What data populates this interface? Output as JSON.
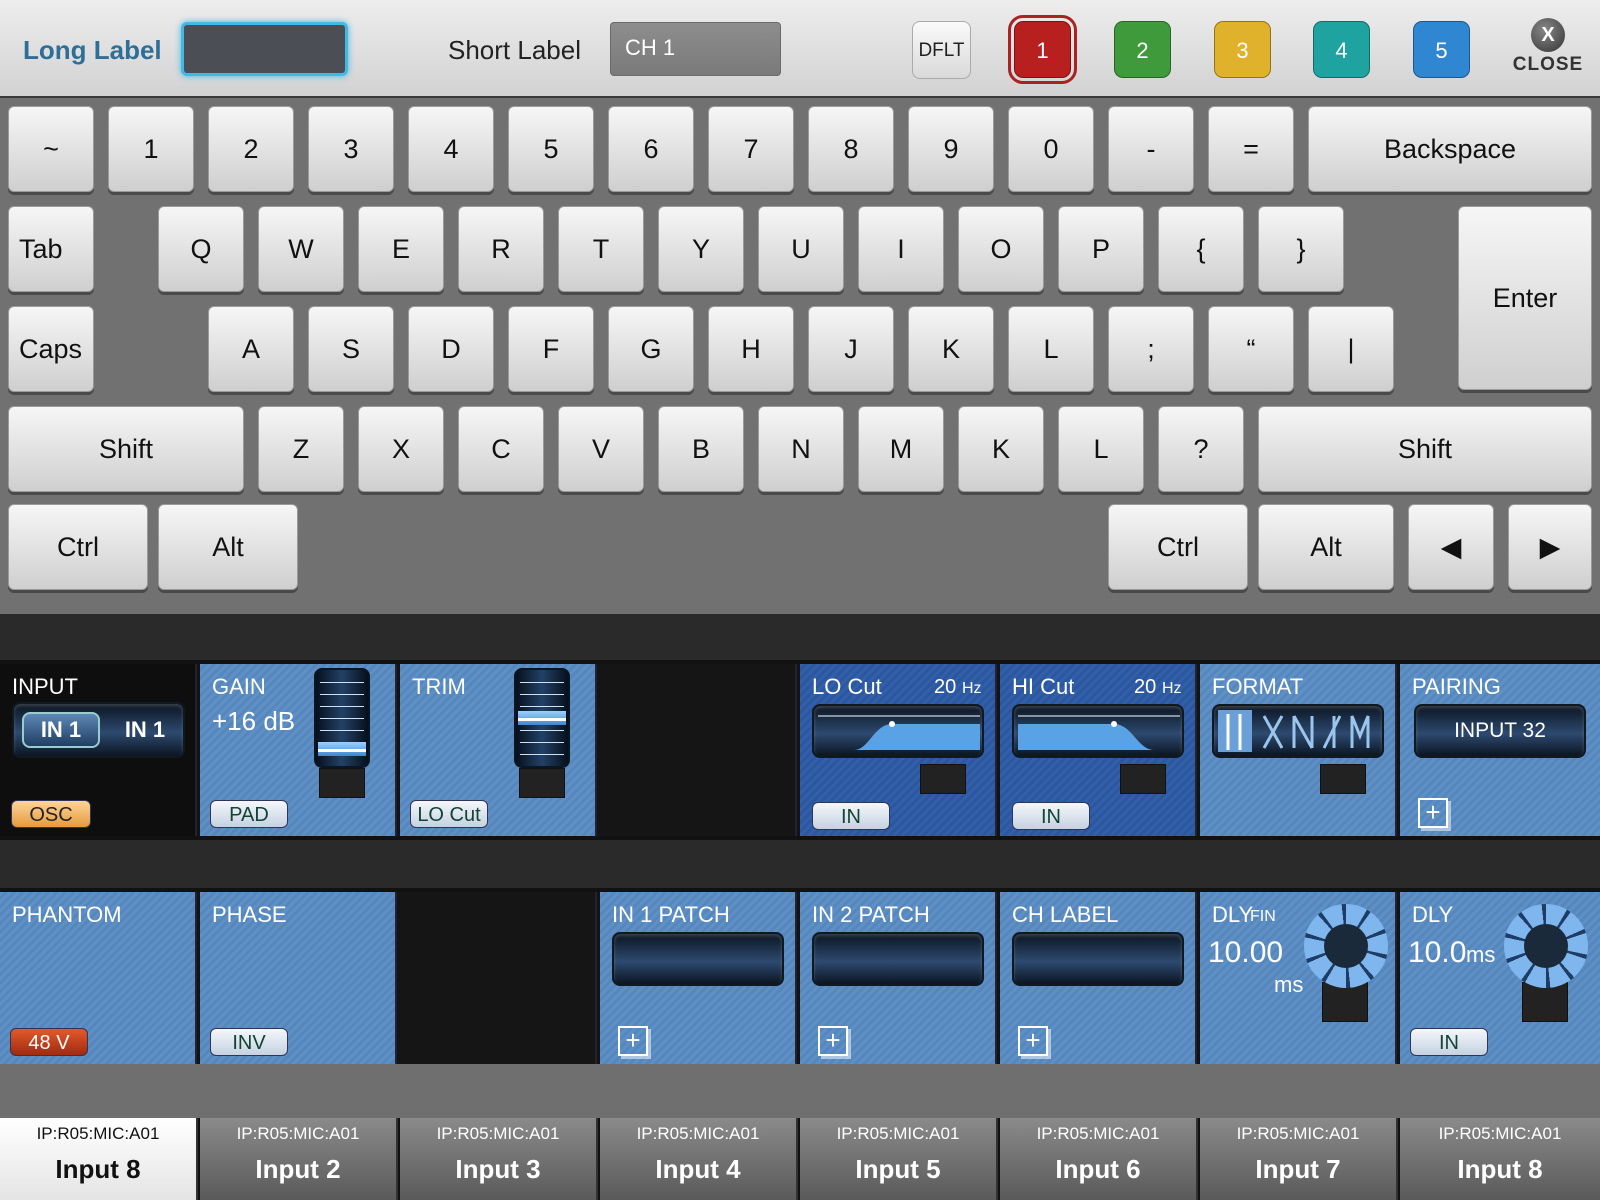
{
  "header": {
    "long_label": "Long Label",
    "long_value": "",
    "short_label": "Short Label",
    "short_value": "CH 1",
    "default_button": "DFLT",
    "color_buttons": [
      {
        "label": "1",
        "color": "#b82020"
      },
      {
        "label": "2",
        "color": "#3f9a3c"
      },
      {
        "label": "3",
        "color": "#e0b22b"
      },
      {
        "label": "4",
        "color": "#1fa3a1"
      },
      {
        "label": "5",
        "color": "#2f86d1"
      }
    ],
    "close_glyph": "X",
    "close_label": "CLOSE"
  },
  "keyboard": {
    "row1": [
      "~",
      "1",
      "2",
      "3",
      "4",
      "5",
      "6",
      "7",
      "8",
      "9",
      "0",
      "-",
      "=",
      "Backspace"
    ],
    "row2": [
      "Tab",
      "Q",
      "W",
      "E",
      "R",
      "T",
      "Y",
      "U",
      "I",
      "O",
      "P",
      "{",
      "}"
    ],
    "row3": [
      "Caps",
      "A",
      "S",
      "D",
      "F",
      "G",
      "H",
      "J",
      "K",
      "L",
      ";",
      "“",
      "|"
    ],
    "row4": [
      "Shift",
      "Z",
      "X",
      "C",
      "V",
      "B",
      "N",
      "M",
      "K",
      "L",
      "?",
      "Shift"
    ],
    "row5": [
      "Ctrl",
      "Alt",
      "Ctrl",
      "Alt",
      "◀",
      "▶"
    ],
    "enter": "Enter"
  },
  "strip1": {
    "input": {
      "title": "INPUT",
      "opt1": "IN 1",
      "opt2": "IN 1",
      "button": "OSC"
    },
    "gain": {
      "title": "GAIN",
      "value": "+16 dB",
      "button": "PAD",
      "level": 0.15
    },
    "trim": {
      "title": "TRIM",
      "button": "LO Cut",
      "level": 0.5
    },
    "locut": {
      "title": "LO Cut",
      "freq": "20",
      "unit": "Hz",
      "button": "IN"
    },
    "hicut": {
      "title": "HI Cut",
      "freq": "20",
      "unit": "Hz",
      "button": "IN"
    },
    "format": {
      "title": "FORMAT"
    },
    "pairing": {
      "title": "PAIRING",
      "value": "INPUT 32"
    }
  },
  "strip2": {
    "phantom": {
      "title": "PHANTOM",
      "button": "48 V"
    },
    "phase": {
      "title": "PHASE",
      "button": "INV"
    },
    "in1patch": {
      "title": "IN 1 PATCH"
    },
    "in2patch": {
      "title": "IN 2 PATCH"
    },
    "chlabel": {
      "title": "CH LABEL"
    },
    "dlyfin": {
      "title": "DLY",
      "sub": "FIN",
      "value": "10.00",
      "unit": "ms"
    },
    "dly": {
      "title": "DLY",
      "value": "10.0",
      "unit": "ms",
      "button": "IN"
    }
  },
  "tabs": [
    {
      "ip": "IP:R05:MIC:A01",
      "name": "Input 8"
    },
    {
      "ip": "IP:R05:MIC:A01",
      "name": "Input 2"
    },
    {
      "ip": "IP:R05:MIC:A01",
      "name": "Input 3"
    },
    {
      "ip": "IP:R05:MIC:A01",
      "name": "Input 4"
    },
    {
      "ip": "IP:R05:MIC:A01",
      "name": "Input 5"
    },
    {
      "ip": "IP:R05:MIC:A01",
      "name": "Input 6"
    },
    {
      "ip": "IP:R05:MIC:A01",
      "name": "Input 7"
    },
    {
      "ip": "IP:R05:MIC:A01",
      "name": "Input 8"
    }
  ]
}
